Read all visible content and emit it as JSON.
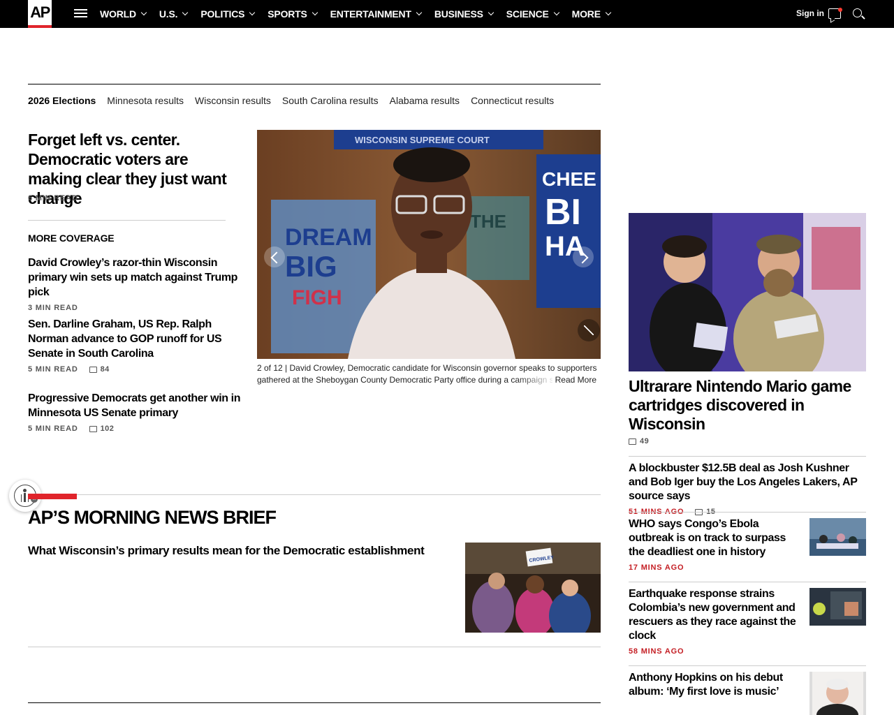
{
  "nav": {
    "logo": "AP",
    "links": [
      "WORLD",
      "U.S.",
      "POLITICS",
      "SPORTS",
      "ENTERTAINMENT",
      "BUSINESS",
      "SCIENCE",
      "MORE"
    ],
    "signin": "Sign in"
  },
  "elections": {
    "items": [
      "2026 Elections",
      "Minnesota results",
      "Wisconsin results",
      "South Carolina results",
      "Alabama results",
      "Connecticut results"
    ]
  },
  "lead": {
    "title": "Forget left vs. center. Democratic voters are making clear they just want change",
    "read": "6 MIN READ",
    "more_coverage": "MORE COVERAGE",
    "stories": [
      {
        "title": "David Crowley’s razor-thin Wisconsin primary win sets up match against Trump pick",
        "read": "3 MIN READ",
        "comments": ""
      },
      {
        "title": "Sen. Darline Graham, US Rep. Ralph Norman advance to GOP runoff for US Senate in South Carolina",
        "read": "5 MIN READ",
        "comments": "84"
      },
      {
        "title": "Progressive Democrats get another win in Minnesota US Senate primary",
        "read": "5 MIN READ",
        "comments": "102"
      }
    ]
  },
  "gallery": {
    "counter": "2 of 12 |",
    "caption": "David Crowley, Democratic candidate for Wisconsin governor speaks to supporters gathered at the Sheboygan County Democratic Party office during a campaign s",
    "read_more": "Read More",
    "sign_top": "WISCONSIN SUPREME COURT",
    "sign_left_1": "DREAM",
    "sign_left_2": "BIG",
    "sign_left_3": "FIGH",
    "sign_right_1": "CHEE",
    "sign_right_2": "BI",
    "sign_right_3": "HA",
    "sign_mid": "THE"
  },
  "brief": {
    "title": "AP’S MORNING NEWS BRIEF",
    "story": "What Wisconsin’s primary results mean for the Democratic establishment",
    "sign_text": "CROWLEY"
  },
  "right": {
    "feature_title": "Ultrarare Nintendo Mario game cartridges discovered in Wisconsin",
    "feature_comments": "49",
    "stories": [
      {
        "title": "A blockbuster $12.5B deal as Josh Kushner and Bob Iger buy the Los Angeles Lakers, AP source says",
        "time": "51 MINS AGO",
        "comments": "15"
      },
      {
        "title": "WHO says Congo’s Ebola outbreak is on track to surpass the deadliest one in history",
        "time": "17 MINS AGO",
        "comments": ""
      },
      {
        "title": "Earthquake response strains Colombia’s new government and rescuers as they race against the clock",
        "time": "58 MINS AGO",
        "comments": ""
      },
      {
        "title": "Anthony Hopkins on his debut album: ‘My first love is music’",
        "time": "",
        "comments": ""
      }
    ]
  },
  "colors": {
    "ap_red": "#e0242b",
    "time_red": "#c41e24",
    "nav_bg": "#000000"
  }
}
